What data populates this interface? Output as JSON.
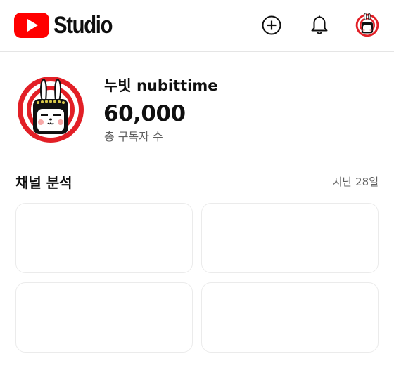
{
  "header": {
    "brand_text": "Studio",
    "brand_color": "#ff0000",
    "create_icon": "add-circle-icon",
    "notification_icon": "bell-icon",
    "account_icon": "avatar"
  },
  "channel": {
    "name": "누빗 nubittime",
    "subscriber_count": "60,000",
    "subscriber_label": "총 구독자 수",
    "avatar_ring_color": "#e21f26"
  },
  "analytics": {
    "title": "채널 분석",
    "period": "지난 28일",
    "cards": [
      "",
      "",
      "",
      ""
    ]
  }
}
